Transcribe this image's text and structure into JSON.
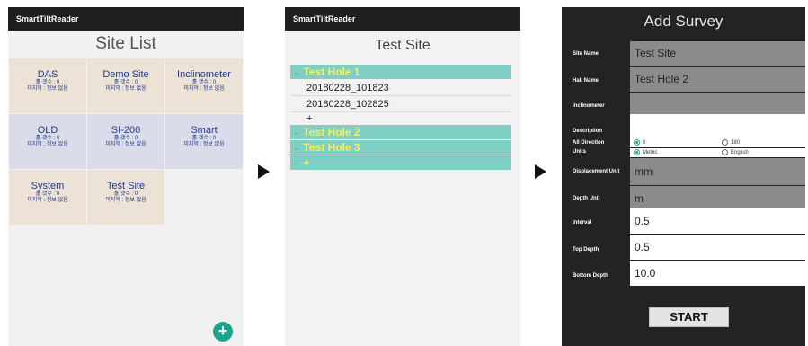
{
  "screen1": {
    "app_title": "SmartTiltReader",
    "page_title": "Site List",
    "tiles": [
      {
        "name": "DAS",
        "line1": "홀 갯수 : 0",
        "line2": "미지막 : 정보 없음",
        "color": "#ece3d6"
      },
      {
        "name": "Demo Site",
        "line1": "홀 갯수 : 0",
        "line2": "미지막 : 정보 없음",
        "color": "#ece3d6"
      },
      {
        "name": "Inclinometer",
        "line1": "홀 갯수 : 0",
        "line2": "미지막 : 정보 없음",
        "color": "#ece3d6"
      },
      {
        "name": "OLD",
        "line1": "홀 갯수 : 0",
        "line2": "미지막 : 정보 없음",
        "color": "#dadde9"
      },
      {
        "name": "SI-200",
        "line1": "홀 갯수 : 0",
        "line2": "미지막 : 정보 없음",
        "color": "#dadde9"
      },
      {
        "name": "Smart",
        "line1": "홀 갯수 : 0",
        "line2": "미지막 : 정보 없음",
        "color": "#dadde9"
      },
      {
        "name": "System",
        "line1": "홀 갯수 : 0",
        "line2": "미지막 : 정보 없음",
        "color": "#ece3d6"
      },
      {
        "name": "Test Site",
        "line1": "홀 갯수 : 0",
        "line2": "미지막 : 정보 없음",
        "color": "#ece3d6"
      }
    ],
    "fab_icon": "plus-icon",
    "fab_label": "+"
  },
  "screen2": {
    "app_title": "SmartTiltReader",
    "page_title": "Test Site",
    "hole1": "Test Hole 1",
    "surveys": [
      "20180228_101823",
      "20180228_102825"
    ],
    "add_survey": "+",
    "hole2": "Test Hole 2",
    "hole3": "Test Hole 3",
    "add_hole": "+"
  },
  "screen3": {
    "page_title": "Add Survey",
    "site_name_label": "Site Name",
    "site_name_value": "Test Site",
    "hall_name_label": "Hall Name",
    "hall_name_value": "Test Hole 2",
    "inclinometer_label": "Inclinometer",
    "inclinometer_value": "",
    "description_label": "Description",
    "description_value": "",
    "all_direction_label": "All Direction",
    "direction_options": [
      "0",
      "180"
    ],
    "direction_selected": "0",
    "units_label": "Units",
    "unit_options": [
      "Metric",
      "English"
    ],
    "unit_selected": "Metric",
    "displacement_unit_label": "Displacement Unit",
    "displacement_unit_value": "mm",
    "depth_unit_label": "Depth Unit",
    "depth_unit_value": "m",
    "interval_label": "Interval",
    "interval_value": "0.5",
    "top_depth_label": "Top Depth",
    "top_depth_value": "0.5",
    "bottom_depth_label": "Bottom Depth",
    "bottom_depth_value": "10.0",
    "start_label": "START"
  },
  "colors": {
    "teal": "#1aa58c",
    "hole_bg": "#7ecfc4",
    "hole_text": "#f6f05a",
    "tile_beige": "#ece3d6",
    "tile_blue": "#dadde9"
  }
}
